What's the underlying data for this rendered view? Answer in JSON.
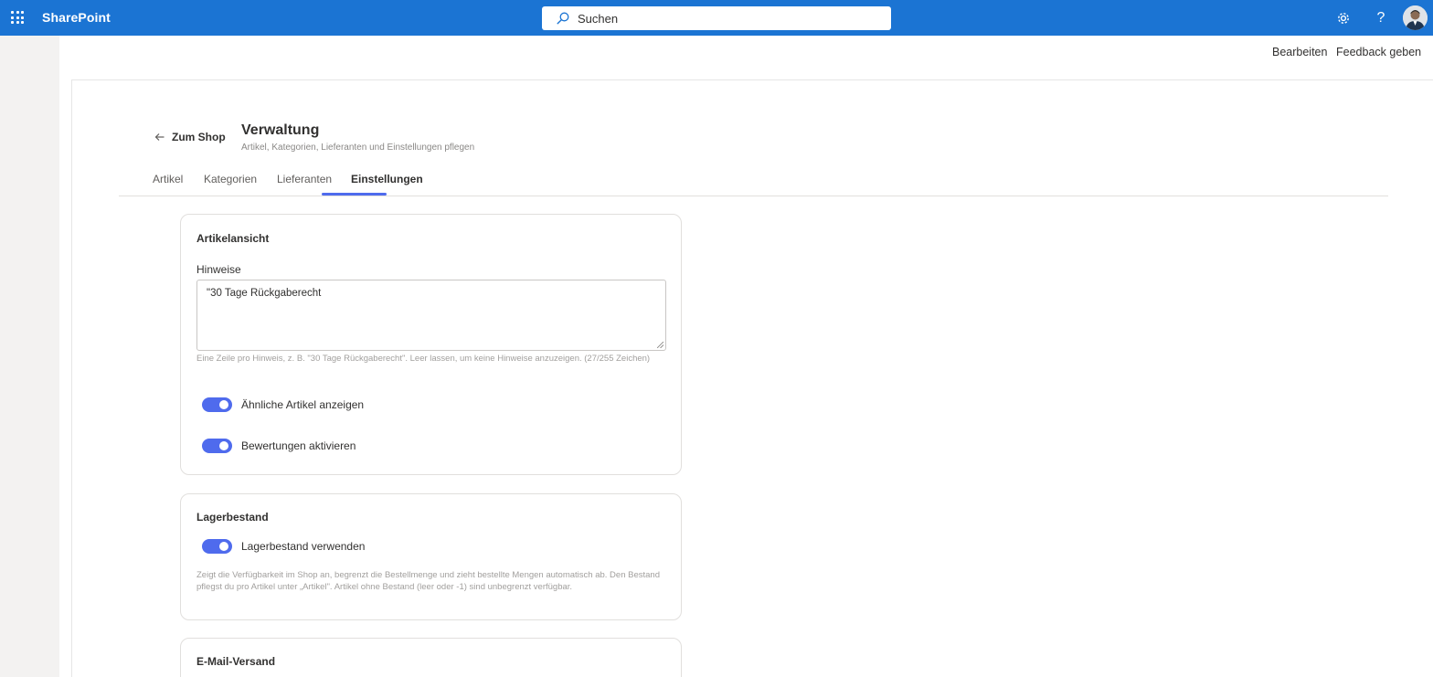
{
  "suitebar": {
    "brand": "SharePoint",
    "search_placeholder": "Suchen"
  },
  "commands": {
    "edit": "Bearbeiten",
    "feedback": "Feedback geben"
  },
  "header": {
    "back_label": "Zum Shop",
    "title": "Verwaltung",
    "subtitle": "Artikel, Kategorien, Lieferanten und Einstellungen pflegen"
  },
  "tabs": [
    {
      "label": "Artikel",
      "active": false
    },
    {
      "label": "Kategorien",
      "active": false
    },
    {
      "label": "Lieferanten",
      "active": false
    },
    {
      "label": "Einstellungen",
      "active": true
    }
  ],
  "article_view": {
    "title": "Artikelansicht",
    "notes_label": "Hinweise",
    "notes_value": "\"30 Tage Rückgaberecht",
    "notes_hint": "Eine Zeile pro Hinweis, z. B. \"30 Tage Rückgaberecht\". Leer lassen, um keine Hinweise anzuzeigen. (27/255 Zeichen)",
    "toggle_similar": {
      "label": "Ähnliche Artikel anzeigen",
      "on": true
    },
    "toggle_ratings": {
      "label": "Bewertungen aktivieren",
      "on": true
    }
  },
  "inventory": {
    "title": "Lagerbestand",
    "toggle_use": {
      "label": "Lagerbestand verwenden",
      "on": true
    },
    "hint": "Zeigt die Verfügbarkeit im Shop an, begrenzt die Bestellmenge und zieht bestellte Mengen automatisch ab. Den Bestand pflegst du pro Artikel unter „Artikel\". Artikel ohne Bestand (leer oder -1) sind unbegrenzt verfügbar."
  },
  "email": {
    "title": "E-Mail-Versand"
  },
  "colors": {
    "suitebar": "#1b74d3",
    "accent": "#4f6bed"
  }
}
